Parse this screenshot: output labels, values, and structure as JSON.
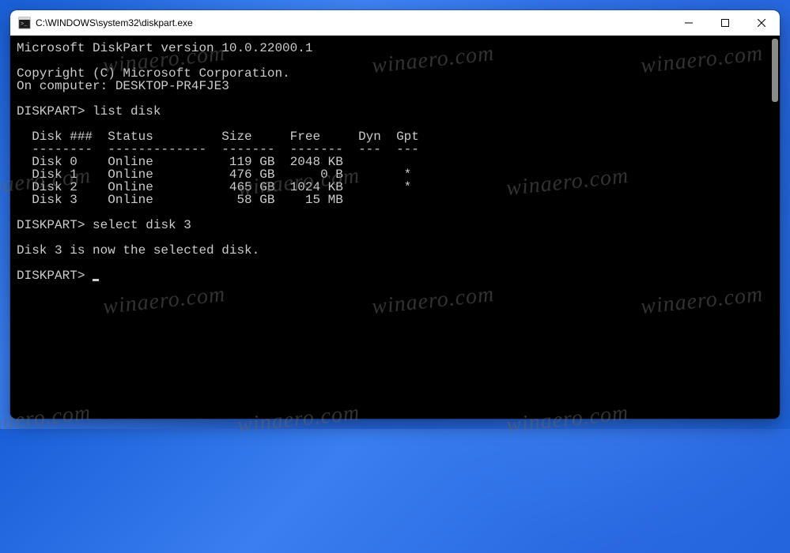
{
  "watermark": "winaero.com",
  "titlebar": {
    "title": "C:\\WINDOWS\\system32\\diskpart.exe"
  },
  "terminal": {
    "header_line": "Microsoft DiskPart version 10.0.22000.1",
    "copyright": "Copyright (C) Microsoft Corporation.",
    "computer": "On computer: DESKTOP-PR4FJE3",
    "prompt": "DISKPART>",
    "command1": "list disk",
    "table": {
      "header": "  Disk ###  Status         Size     Free     Dyn  Gpt",
      "divider": "  --------  -------------  -------  -------  ---  ---",
      "rows": [
        "  Disk 0    Online          119 GB  2048 KB",
        "  Disk 1    Online          476 GB      0 B        *",
        "  Disk 2    Online          465 GB  1024 KB        *",
        "  Disk 3    Online           58 GB    15 MB"
      ]
    },
    "command2": "select disk 3",
    "result": "Disk 3 is now the selected disk."
  }
}
